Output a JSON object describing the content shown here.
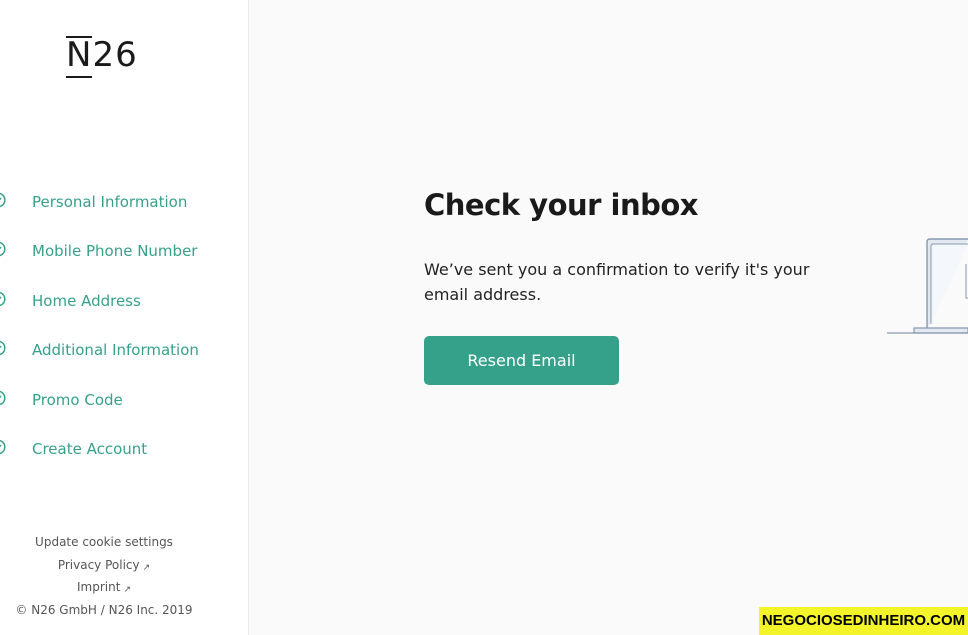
{
  "logo": "N26",
  "steps": [
    {
      "label": "Personal Information"
    },
    {
      "label": "Mobile Phone Number"
    },
    {
      "label": "Home Address"
    },
    {
      "label": "Additional Information"
    },
    {
      "label": "Promo Code"
    },
    {
      "label": "Create Account"
    }
  ],
  "footer": {
    "cookie": "Update cookie settings",
    "privacy": "Privacy Policy",
    "imprint": "Imprint",
    "copyright": "© N26 GmbH / N26 Inc. 2019"
  },
  "main": {
    "heading": "Check your inbox",
    "message": "We’ve sent you a confirmation to verify it's your email address.",
    "button": "Resend Email"
  },
  "watermark": "NEGOCIOSEDINHEIRO.COM",
  "colors": {
    "accent": "#36a18b",
    "background": "#fafafa",
    "watermark_bg": "#f4f42a"
  },
  "icons": {
    "step_status": "check-circle-icon",
    "external_link": "external-link-icon",
    "illustration": "laptop-illustration"
  }
}
